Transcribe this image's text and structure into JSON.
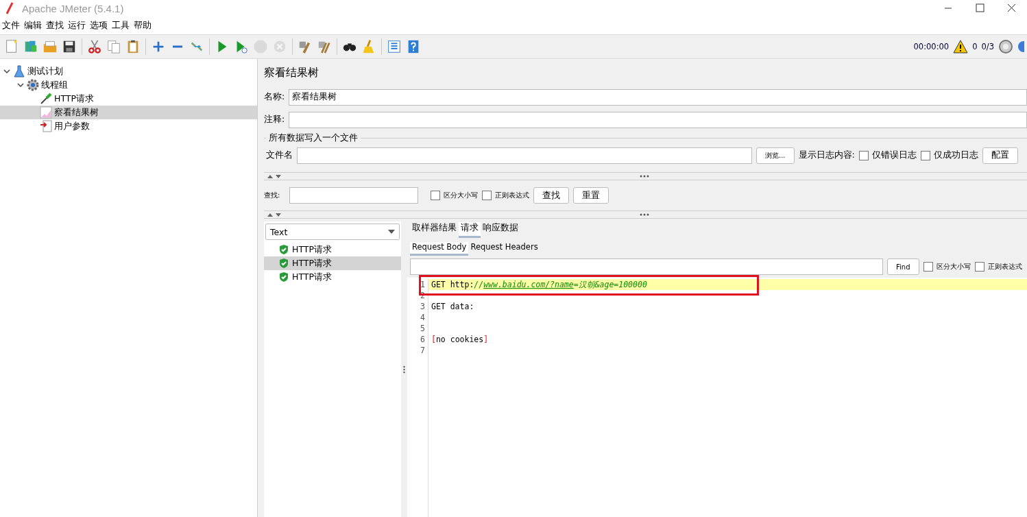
{
  "window": {
    "title": "Apache JMeter (5.4.1)"
  },
  "menu": [
    "文件",
    "编辑",
    "查找",
    "运行",
    "选项",
    "工具",
    "帮助"
  ],
  "toolbar": {
    "buttons": [
      {
        "kind": "new"
      },
      {
        "kind": "templates"
      },
      {
        "kind": "open"
      },
      {
        "kind": "save"
      },
      {
        "kind": "separator"
      },
      {
        "kind": "cut"
      },
      {
        "kind": "copy"
      },
      {
        "kind": "paste"
      },
      {
        "kind": "separator"
      },
      {
        "kind": "expand"
      },
      {
        "kind": "collapse"
      },
      {
        "kind": "toggle"
      },
      {
        "kind": "separator"
      },
      {
        "kind": "start"
      },
      {
        "kind": "start-no-timers"
      },
      {
        "kind": "stop",
        "disabled": true
      },
      {
        "kind": "shutdown",
        "disabled": true
      },
      {
        "kind": "separator"
      },
      {
        "kind": "clear"
      },
      {
        "kind": "clear-all"
      },
      {
        "kind": "separator"
      },
      {
        "kind": "search"
      },
      {
        "kind": "reset-search"
      },
      {
        "kind": "separator"
      },
      {
        "kind": "function-helper"
      },
      {
        "kind": "help"
      }
    ],
    "timer": "00:00:00",
    "errors": "0",
    "threads": "0/3"
  },
  "tree": [
    {
      "label": "测试计划",
      "kind": "test-plan",
      "expanded": true,
      "selected": false,
      "children": [
        {
          "label": "线程组",
          "kind": "thread-group",
          "expanded": true,
          "selected": false,
          "children": [
            {
              "label": "HTTP请求",
              "kind": "sampler",
              "selected": false
            },
            {
              "label": "察看结果树",
              "kind": "listener",
              "selected": true
            },
            {
              "label": "用户参数",
              "kind": "config",
              "selected": false
            }
          ]
        }
      ]
    }
  ],
  "panel": {
    "title": "察看结果树",
    "name_label": "名称:",
    "name_value": "察看结果树",
    "comment_label": "注释:",
    "file_group": {
      "legend": "所有数据写入一个文件",
      "file_label": "文件名",
      "browse_button": "浏览...",
      "log_label": "显示日志内容:",
      "checkboxes": [
        {
          "label": "仅错误日志",
          "checked": false
        },
        {
          "label": "仅成功日志",
          "checked": false
        }
      ],
      "config_button": "配置"
    },
    "search": {
      "label": "查找:",
      "options": [
        {
          "label": "区分大小写",
          "checked": false
        },
        {
          "label": "正则表达式",
          "checked": false
        }
      ],
      "find_button": "查找",
      "reset_button": "重置"
    }
  },
  "results": {
    "renderer": "Text",
    "samples": [
      {
        "label": "HTTP请求",
        "selected": false
      },
      {
        "label": "HTTP请求",
        "selected": true
      },
      {
        "label": "HTTP请求",
        "selected": false
      }
    ],
    "tabs": [
      {
        "label": "取样器结果",
        "selected": false
      },
      {
        "label": "请求",
        "selected": true
      },
      {
        "label": "响应数据",
        "selected": false
      }
    ],
    "subtabs": [
      {
        "label": "Request Body",
        "selected": true
      },
      {
        "label": "Request Headers",
        "selected": false
      }
    ],
    "find_button": "Find",
    "find_options": [
      {
        "label": "区分大小写",
        "checked": false
      },
      {
        "label": "正则表达式",
        "checked": false
      }
    ],
    "lines": [
      {
        "number": "1",
        "highlighted": true,
        "segments": [
          {
            "kind": "plain",
            "text": "GET http:"
          },
          {
            "kind": "value",
            "text": "//"
          },
          {
            "kind": "link",
            "text": "www.baidu.com/?name"
          },
          {
            "kind": "value",
            "text": "=汉朝&age=100000"
          }
        ]
      },
      {
        "number": "2",
        "highlighted": false
      },
      {
        "number": "3",
        "highlighted": false,
        "segments": [
          {
            "kind": "plain",
            "text": "GET data:"
          }
        ]
      },
      {
        "number": "4",
        "highlighted": false
      },
      {
        "number": "5",
        "highlighted": false
      },
      {
        "number": "6",
        "highlighted": false,
        "segments": [
          {
            "kind": "bracket",
            "text": "["
          },
          {
            "kind": "plain",
            "text": "no cookies"
          },
          {
            "kind": "bracket",
            "text": "]"
          }
        ]
      },
      {
        "number": "7",
        "highlighted": false
      }
    ]
  }
}
